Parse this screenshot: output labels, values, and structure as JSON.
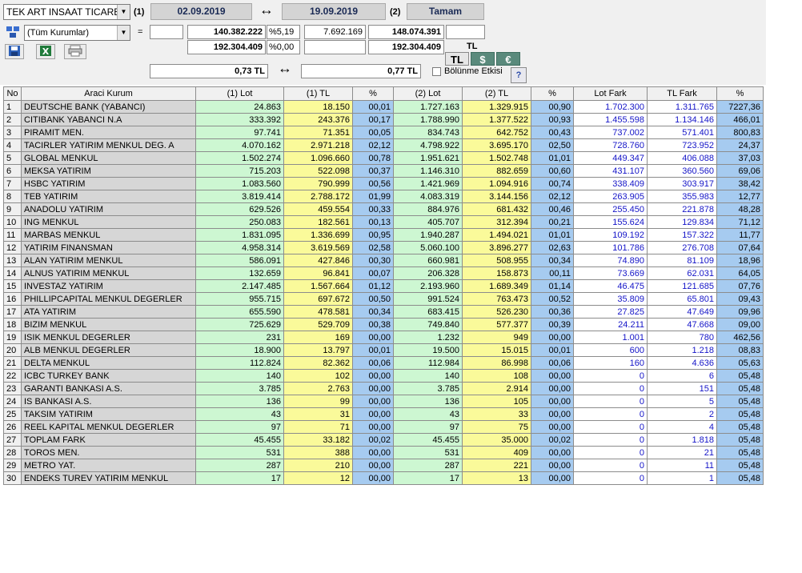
{
  "header": {
    "symbol": "TEK ART INSAAT TICARET",
    "marker1": "(1)",
    "date1": "02.09.2019",
    "swap_icon": "↔",
    "date2": "19.09.2019",
    "marker2": "(2)",
    "ok_label": "Tamam",
    "institution": "(Tüm Kurumlar)",
    "equals": "=",
    "row1": {
      "v1": "140.382.222",
      "p1": "%5,19",
      "v2": "7.692.169",
      "v3": "148.074.391"
    },
    "row2": {
      "v1": "192.304.409",
      "p1": "%0,00",
      "v3": "192.304.409"
    },
    "currency_caption": "TL",
    "currencies": [
      "TL",
      "$",
      "€"
    ],
    "price1": "0,73 TL",
    "price2": "0,77 TL",
    "split_label": "Bölünme Etkisi",
    "help_label": "?",
    "icons": {
      "filter": "filter-icon",
      "save": "save-icon",
      "excel": "excel-icon",
      "print": "print-icon"
    }
  },
  "colors": {
    "green": "#cdf7d2",
    "yellow": "#fafa9a",
    "blue": "#a6cbf0",
    "name": "#d6d6d6",
    "fark": "#1414c8"
  },
  "table": {
    "columns": [
      "No",
      "Araci Kurum",
      "(1) Lot",
      "(1) TL",
      "%",
      "(2) Lot",
      "(2) TL",
      "%",
      "Lot Fark",
      "TL Fark",
      "%"
    ],
    "rows": [
      [
        "1",
        "DEUTSCHE BANK (YABANCI)",
        "24.863",
        "18.150",
        "00,01",
        "1.727.163",
        "1.329.915",
        "00,90",
        "1.702.300",
        "1.311.765",
        "7227,36"
      ],
      [
        "2",
        "CITIBANK YABANCI N.A",
        "333.392",
        "243.376",
        "00,17",
        "1.788.990",
        "1.377.522",
        "00,93",
        "1.455.598",
        "1.134.146",
        "466,01"
      ],
      [
        "3",
        "PIRAMIT MEN.",
        "97.741",
        "71.351",
        "00,05",
        "834.743",
        "642.752",
        "00,43",
        "737.002",
        "571.401",
        "800,83"
      ],
      [
        "4",
        "TACIRLER YATIRIM MENKUL DEG. A",
        "4.070.162",
        "2.971.218",
        "02,12",
        "4.798.922",
        "3.695.170",
        "02,50",
        "728.760",
        "723.952",
        "24,37"
      ],
      [
        "5",
        "GLOBAL MENKUL",
        "1.502.274",
        "1.096.660",
        "00,78",
        "1.951.621",
        "1.502.748",
        "01,01",
        "449.347",
        "406.088",
        "37,03"
      ],
      [
        "6",
        "MEKSA YATIRIM",
        "715.203",
        "522.098",
        "00,37",
        "1.146.310",
        "882.659",
        "00,60",
        "431.107",
        "360.560",
        "69,06"
      ],
      [
        "7",
        "HSBC YATIRIM",
        "1.083.560",
        "790.999",
        "00,56",
        "1.421.969",
        "1.094.916",
        "00,74",
        "338.409",
        "303.917",
        "38,42"
      ],
      [
        "8",
        "TEB YATIRIM",
        "3.819.414",
        "2.788.172",
        "01,99",
        "4.083.319",
        "3.144.156",
        "02,12",
        "263.905",
        "355.983",
        "12,77"
      ],
      [
        "9",
        "ANADOLU YATIRIM",
        "629.526",
        "459.554",
        "00,33",
        "884.976",
        "681.432",
        "00,46",
        "255.450",
        "221.878",
        "48,28"
      ],
      [
        "10",
        "ING MENKUL",
        "250.083",
        "182.561",
        "00,13",
        "405.707",
        "312.394",
        "00,21",
        "155.624",
        "129.834",
        "71,12"
      ],
      [
        "11",
        "MARBAS MENKUL",
        "1.831.095",
        "1.336.699",
        "00,95",
        "1.940.287",
        "1.494.021",
        "01,01",
        "109.192",
        "157.322",
        "11,77"
      ],
      [
        "12",
        "YATIRIM FINANSMAN",
        "4.958.314",
        "3.619.569",
        "02,58",
        "5.060.100",
        "3.896.277",
        "02,63",
        "101.786",
        "276.708",
        "07,64"
      ],
      [
        "13",
        "ALAN YATIRIM MENKUL",
        "586.091",
        "427.846",
        "00,30",
        "660.981",
        "508.955",
        "00,34",
        "74.890",
        "81.109",
        "18,96"
      ],
      [
        "14",
        "ALNUS YATIRIM MENKUL",
        "132.659",
        "96.841",
        "00,07",
        "206.328",
        "158.873",
        "00,11",
        "73.669",
        "62.031",
        "64,05"
      ],
      [
        "15",
        "INVESTAZ YATIRIM",
        "2.147.485",
        "1.567.664",
        "01,12",
        "2.193.960",
        "1.689.349",
        "01,14",
        "46.475",
        "121.685",
        "07,76"
      ],
      [
        "16",
        "PHILLIPCAPITAL MENKUL DEGERLER",
        "955.715",
        "697.672",
        "00,50",
        "991.524",
        "763.473",
        "00,52",
        "35.809",
        "65.801",
        "09,43"
      ],
      [
        "17",
        "ATA YATIRIM",
        "655.590",
        "478.581",
        "00,34",
        "683.415",
        "526.230",
        "00,36",
        "27.825",
        "47.649",
        "09,96"
      ],
      [
        "18",
        "BIZIM MENKUL",
        "725.629",
        "529.709",
        "00,38",
        "749.840",
        "577.377",
        "00,39",
        "24.211",
        "47.668",
        "09,00"
      ],
      [
        "19",
        "ISIK MENKUL DEGERLER",
        "231",
        "169",
        "00,00",
        "1.232",
        "949",
        "00,00",
        "1.001",
        "780",
        "462,56"
      ],
      [
        "20",
        "ALB MENKUL DEGERLER",
        "18.900",
        "13.797",
        "00,01",
        "19.500",
        "15.015",
        "00,01",
        "600",
        "1.218",
        "08,83"
      ],
      [
        "21",
        "DELTA MENKUL",
        "112.824",
        "82.362",
        "00,06",
        "112.984",
        "86.998",
        "00,06",
        "160",
        "4.636",
        "05,63"
      ],
      [
        "22",
        "ICBC TURKEY BANK",
        "140",
        "102",
        "00,00",
        "140",
        "108",
        "00,00",
        "0",
        "6",
        "05,48"
      ],
      [
        "23",
        "GARANTI BANKASI A.S.",
        "3.785",
        "2.763",
        "00,00",
        "3.785",
        "2.914",
        "00,00",
        "0",
        "151",
        "05,48"
      ],
      [
        "24",
        "IS BANKASI A.S.",
        "136",
        "99",
        "00,00",
        "136",
        "105",
        "00,00",
        "0",
        "5",
        "05,48"
      ],
      [
        "25",
        "TAKSIM YATIRIM",
        "43",
        "31",
        "00,00",
        "43",
        "33",
        "00,00",
        "0",
        "2",
        "05,48"
      ],
      [
        "26",
        "REEL KAPITAL MENKUL DEGERLER",
        "97",
        "71",
        "00,00",
        "97",
        "75",
        "00,00",
        "0",
        "4",
        "05,48"
      ],
      [
        "27",
        "TOPLAM FARK",
        "45.455",
        "33.182",
        "00,02",
        "45.455",
        "35.000",
        "00,02",
        "0",
        "1.818",
        "05,48"
      ],
      [
        "28",
        "TOROS MEN.",
        "531",
        "388",
        "00,00",
        "531",
        "409",
        "00,00",
        "0",
        "21",
        "05,48"
      ],
      [
        "29",
        "METRO YAT.",
        "287",
        "210",
        "00,00",
        "287",
        "221",
        "00,00",
        "0",
        "11",
        "05,48"
      ],
      [
        "30",
        "ENDEKS TUREV YATIRIM MENKUL",
        "17",
        "12",
        "00,00",
        "17",
        "13",
        "00,00",
        "0",
        "1",
        "05,48"
      ]
    ]
  }
}
